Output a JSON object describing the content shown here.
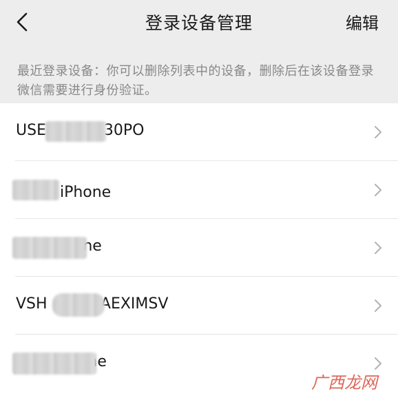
{
  "nav": {
    "title": "登录设备管理",
    "edit_label": "编辑"
  },
  "hint": {
    "text": "最近登录设备：你可以删除列表中的设备，删除后在该设备登录微信需要进行身份验证。"
  },
  "devices": [
    {
      "visible_name": "USE        0330PO"
    },
    {
      "visible_name": "     的 iPhone"
    },
    {
      "visible_name": "          hone"
    },
    {
      "visible_name": "VSH         RAEXIMSV"
    },
    {
      "visible_name": "             one"
    }
  ],
  "watermark": {
    "text": "广西龙网"
  }
}
